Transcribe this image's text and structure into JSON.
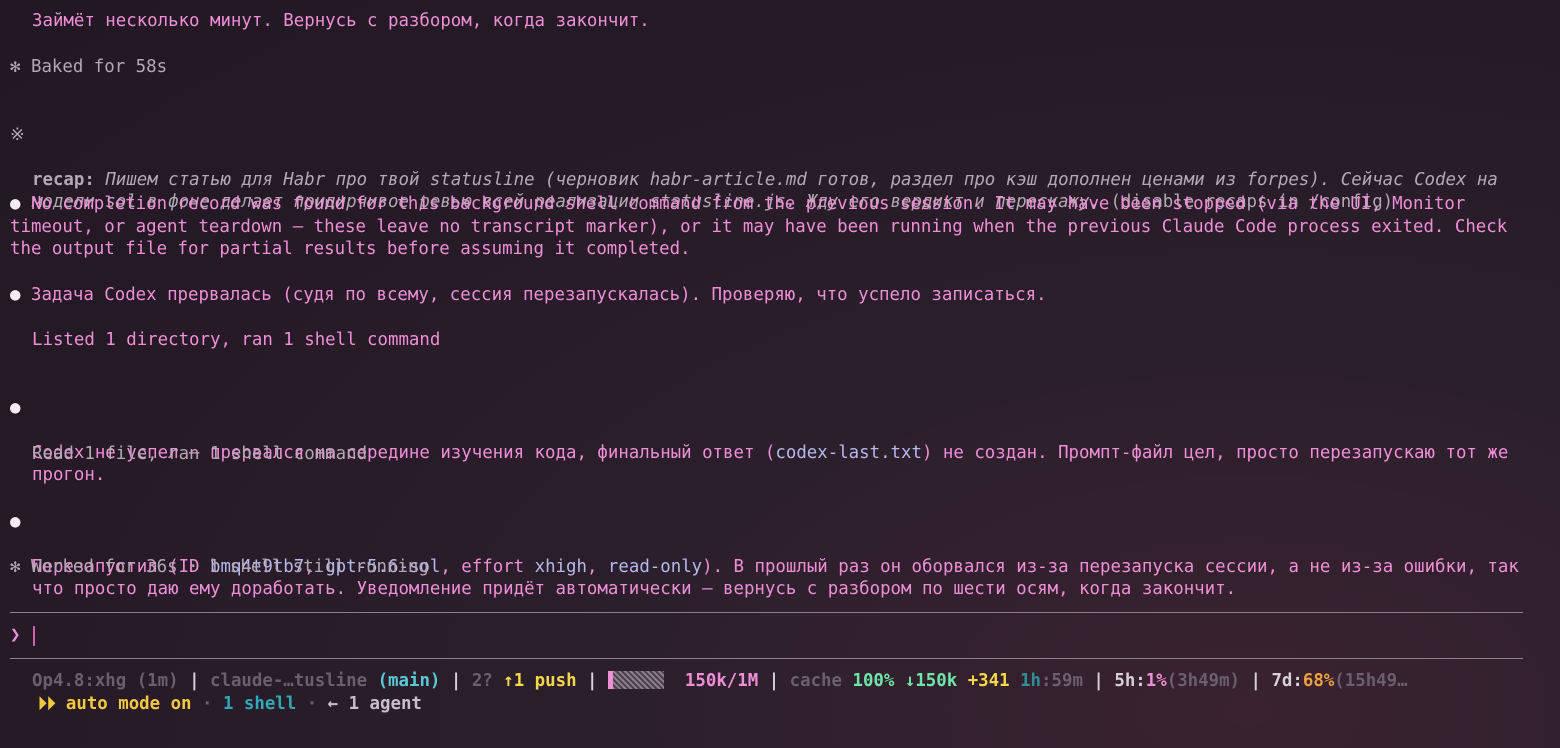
{
  "transcript": {
    "line1": "Займёт несколько минут. Вернусь с разбором, когда закончит.",
    "baked": {
      "glyph": "✻",
      "text": "Baked for 58s"
    },
    "recap": {
      "glyph": "※",
      "label": "recap:",
      "text": "Пишем статью для Habr про твой statusline (черновик habr-article.md готов, раздел про кэш дополнен ценами из forpes). Сейчас Codex на модели sol в фоне делает придирчивое ревью всей реализации statusline.js. Жду его вердикт и перескажу.",
      "hint": "(disable recaps in /config)"
    },
    "bullet1": {
      "glyph": "●",
      "text": "No completion record was found for this background shell command from the previous session. It may have been stopped (via the UI, Monitor timeout, or agent teardown — these leave no transcript marker), or it may have been running when the previous Claude Code process exited. Check the output file for partial results before assuming it completed."
    },
    "bullet2": {
      "glyph": "●",
      "text": "Задача Codex прервалась (судя по всему, сессия перезапускалась). Проверяю, что успело записаться."
    },
    "tool1": "Listed 1 directory, ran 1 shell command",
    "bullet3": {
      "glyph": "●",
      "pre": "Codex не успел — прервался на середине изучения кода, финальный ответ (",
      "code": "codex-last.txt",
      "post": ") не создан. Промпт-файл цел, просто перезапускаю тот же прогон."
    },
    "tool2": "Read 1 file, ran 1 shell command",
    "bullet4": {
      "glyph": "●",
      "t1": "Перезапустил (ID ",
      "c1": "bmq4t9tb7",
      "t2": ", ",
      "c2": "gpt-5.6-sol",
      "t3": ", effort ",
      "c3": "xhigh",
      "t4": ", ",
      "c4": "read-only",
      "t5": "). В прошлый раз он оборвался из-за перезапуска сессии, а не из-за ошибки, так что просто даю ему доработать. Уведомление придёт автоматически — вернусь с разбором по шести осям, когда закончит."
    },
    "worked": {
      "glyph": "✻",
      "text": "Worked for 36s · 1 shell still running"
    }
  },
  "prompt": {
    "glyph": "❯",
    "value": ""
  },
  "statusline": {
    "model": "Op4.8:xhg (1m)",
    "sep1": " | ",
    "dir": "claude-…tusline",
    "branch": "(main)",
    "sep2": " | ",
    "untracked": "2?",
    "push": "↑1 push",
    "sep3": " | ",
    "context": "150k/1M",
    "sep4": " | ",
    "cache_label": "cache",
    "cache_pct": "100%",
    "cache_read": "↓150k",
    "cache_write": "+341",
    "ttl_h": "1h",
    "ttl_rest": ":59m",
    "sep5": " | ",
    "five_label": "5h:",
    "five_pct": "1%",
    "five_reset": "(3h49m)",
    "sep6": " | ",
    "seven_label": "7d:",
    "seven_pct": "68%",
    "seven_reset": "(15h49…",
    "context_fill": 0.15
  },
  "modeline": {
    "arrows": "⏵⏵",
    "mode": "auto mode on",
    "dot1": " · ",
    "shells": "1 shell",
    "dot2": " · ",
    "agents": "← 1 agent"
  },
  "colors": {
    "background": "#261b27",
    "pink": "#f08ed8",
    "code": "#b6b9ef",
    "cyan": "#5ac8d8",
    "yellow": "#f5d84a",
    "green": "#6ee6a8",
    "orange": "#f0a040"
  }
}
